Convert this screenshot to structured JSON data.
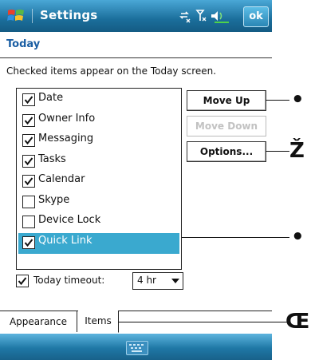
{
  "titlebar": {
    "title": "Settings",
    "ok_label": "ok"
  },
  "page": {
    "header": "Today",
    "instructions": "Checked items appear on the Today screen."
  },
  "items": [
    {
      "label": "Date",
      "checked": true,
      "selected": false
    },
    {
      "label": "Owner Info",
      "checked": true,
      "selected": false
    },
    {
      "label": "Messaging",
      "checked": true,
      "selected": false
    },
    {
      "label": "Tasks",
      "checked": true,
      "selected": false
    },
    {
      "label": "Calendar",
      "checked": true,
      "selected": false
    },
    {
      "label": "Skype",
      "checked": false,
      "selected": false
    },
    {
      "label": "Device Lock",
      "checked": false,
      "selected": false
    },
    {
      "label": "Quick Link",
      "checked": true,
      "selected": true
    }
  ],
  "buttons": {
    "move_up": "Move Up",
    "move_down": "Move Down",
    "options": "Options..."
  },
  "timeout": {
    "checked": true,
    "label": "Today timeout:",
    "value": "4 hr"
  },
  "tabs": {
    "appearance": "Appearance",
    "items": "Items"
  },
  "callouts": {
    "c1": "•",
    "c2": "Ž",
    "c3": "•",
    "c4": "Œ"
  },
  "colors": {
    "titlebar": "#1b6f9c",
    "selection": "#3aa9cf",
    "header_text": "#1a5ea3"
  }
}
